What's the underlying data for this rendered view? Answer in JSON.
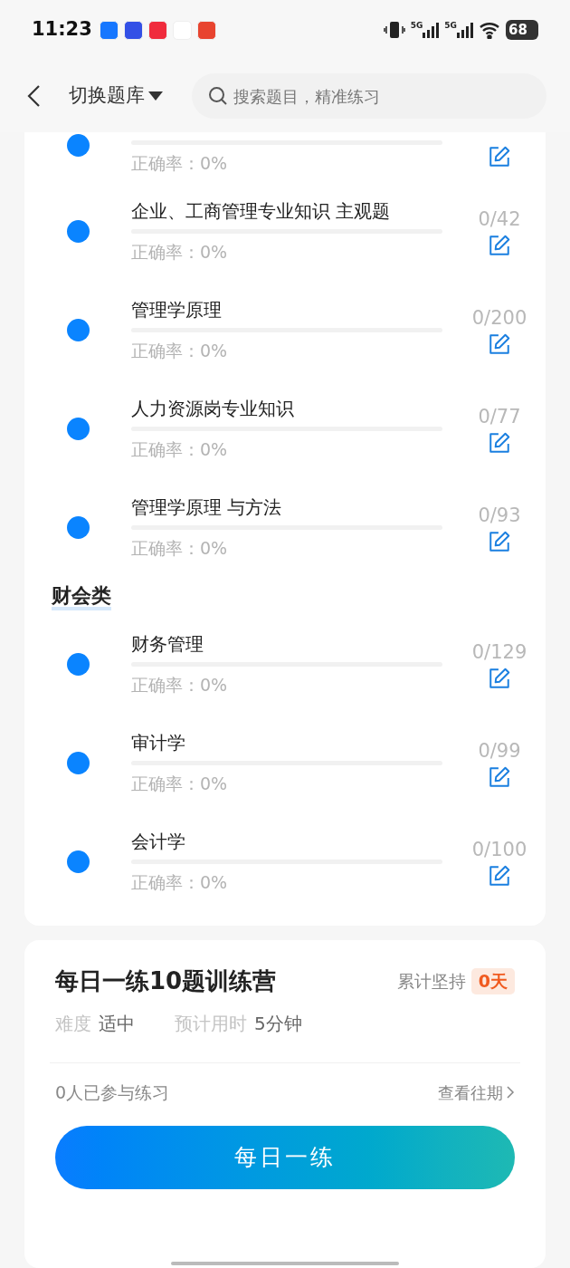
{
  "status_bar": {
    "time": "11:23",
    "battery": "68",
    "network_1": "5G",
    "network_2": "5G",
    "apps": [
      {
        "color": "#1677ff"
      },
      {
        "color": "#3350e6"
      },
      {
        "color": "#f02b3c"
      },
      {
        "color": "#ffffff"
      },
      {
        "color": "#e8442f"
      }
    ]
  },
  "header": {
    "title": "切换题库",
    "search": {
      "placeholder": "搜索题目，精准练习"
    }
  },
  "partial_item": {
    "rate": "正确率：0%"
  },
  "sections": [
    {
      "items": [
        {
          "name": "企业、工商管理专业知识 主观题",
          "count": "0/42",
          "rate": "正确率：0%"
        },
        {
          "name": "管理学原理",
          "count": "0/200",
          "rate": "正确率：0%"
        },
        {
          "name": "人力资源岗专业知识",
          "count": "0/77",
          "rate": "正确率：0%"
        },
        {
          "name": "管理学原理 与方法",
          "count": "0/93",
          "rate": "正确率：0%"
        }
      ]
    },
    {
      "title": "财会类",
      "items": [
        {
          "name": "财务管理",
          "count": "0/129",
          "rate": "正确率：0%"
        },
        {
          "name": "审计学",
          "count": "0/99",
          "rate": "正确率：0%"
        },
        {
          "name": "会计学",
          "count": "0/100",
          "rate": "正确率：0%"
        }
      ]
    }
  ],
  "camp": {
    "title": "每日一练10题训练营",
    "streak_label": "累计坚持",
    "streak": "0天",
    "difficulty_label": "难度",
    "difficulty": "适中",
    "time_label": "预计用时",
    "time": "5分钟",
    "participants": "0人已参与练习",
    "history_link": "查看往期",
    "button": "每日一练"
  }
}
